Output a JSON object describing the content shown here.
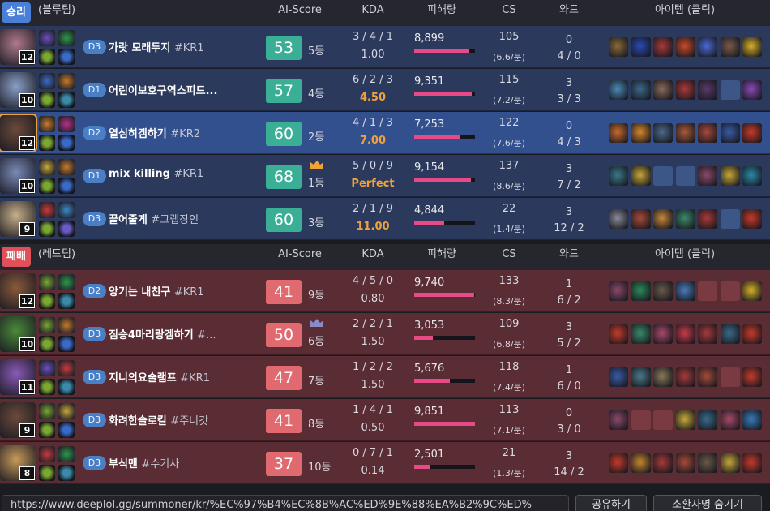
{
  "columns": {
    "ai_score": "AI-Score",
    "kda": "KDA",
    "damage": "피해량",
    "cs": "CS",
    "ward": "와드",
    "items": "아이템 (클릭)"
  },
  "teams": [
    {
      "result": "승리",
      "team": "(블루팀)",
      "result_color": "#4a7fd8",
      "kind": "win",
      "players": [
        {
          "level": "12",
          "tier": "D3",
          "name": "가랏 모래두지",
          "tag": "#KR1",
          "score": "53",
          "rank": "5등",
          "kda": "3 / 4 / 1",
          "ratio": "1.00",
          "ratio_hi": false,
          "damage": "8,899",
          "damage_pct": 0.9,
          "cs": "105",
          "cs_min": "(6.6/분)",
          "ward1": "0",
          "ward2": "4 / 0",
          "crown": null,
          "me": false,
          "champ_color": "#b07a8c",
          "spells": [
            "#6b4ec2",
            "#2c9a4a",
            "#7aa830",
            "#3a6ac8"
          ],
          "items": [
            "#8a6a3a",
            "#2a4ab8",
            "#a83a3a",
            "#c84a2a",
            "#4a6ad8",
            "#7a5a4a",
            "#d8b02a"
          ]
        },
        {
          "level": "10",
          "tier": "D1",
          "name": "어린이보호구역스피드...",
          "tag": "",
          "score": "57",
          "rank": "4등",
          "kda": "6 / 2 / 3",
          "ratio": "4.50",
          "ratio_hi": true,
          "damage": "9,351",
          "damage_pct": 0.95,
          "cs": "115",
          "cs_min": "(7.2/분)",
          "ward1": "3",
          "ward2": "3 / 3",
          "crown": null,
          "me": false,
          "champ_color": "#8aa0c8",
          "spells": [
            "#3a6ac8",
            "#c87a2a",
            "#7aa830",
            "#3a8aa8"
          ],
          "items": [
            "#4a8ab8",
            "#3a6a8a",
            "#8a6a5a",
            "#a83a3a",
            "#5a3a6a",
            "",
            "#8a4ab8"
          ]
        },
        {
          "level": "12",
          "tier": "D2",
          "name": "열심히겜하기",
          "tag": "#KR2",
          "score": "60",
          "rank": "2등",
          "kda": "4 / 1 / 3",
          "ratio": "7.00",
          "ratio_hi": true,
          "damage": "7,253",
          "damage_pct": 0.74,
          "cs": "122",
          "cs_min": "(7.6/분)",
          "ward1": "0",
          "ward2": "4 / 3",
          "crown": null,
          "me": true,
          "champ_color": "#6a4a3a",
          "spells": [
            "#c87a2a",
            "#b8308a",
            "#7aa830",
            "#3a6ac8"
          ],
          "items": [
            "#c86a2a",
            "#d8882a",
            "#4a6a8a",
            "#a85a3a",
            "#a84a3a",
            "#3a5aa8",
            "#c83a2a"
          ]
        },
        {
          "level": "10",
          "tier": "D1",
          "name": "mix killing",
          "tag": "#KR1",
          "score": "68",
          "rank": "1등",
          "kda": "5 / 0 / 9",
          "ratio": "Perfect",
          "ratio_hi": true,
          "damage": "9,154",
          "damage_pct": 0.93,
          "cs": "137",
          "cs_min": "(8.6/분)",
          "ward1": "3",
          "ward2": "7 / 2",
          "crown": "#f0a23a",
          "me": false,
          "champ_color": "#7a8ab8",
          "spells": [
            "#c8a83a",
            "#c87a2a",
            "#7aa830",
            "#3a6ac8"
          ],
          "items": [
            "#3a7a8a",
            "#c8a83a",
            "",
            "",
            "#8a4a6a",
            "#c8a83a",
            "#2a8aa8"
          ]
        },
        {
          "level": "9",
          "tier": "D3",
          "name": "끝어줄게",
          "tag": "#그랩장인",
          "score": "60",
          "rank": "3등",
          "kda": "2 / 1 / 9",
          "ratio": "11.00",
          "ratio_hi": true,
          "damage": "4,844",
          "damage_pct": 0.49,
          "cs": "22",
          "cs_min": "(1.4/분)",
          "ward1": "3",
          "ward2": "12 / 2",
          "crown": null,
          "me": false,
          "champ_color": "#c8b08a",
          "spells": [
            "#c83a3a",
            "#3a8ac8",
            "#7aa830",
            "#6a5ac8"
          ],
          "items": [
            "#8a8a9a",
            "#a84a3a",
            "#c8883a",
            "#3a8a6a",
            "#a83a3a",
            "",
            "#c83a2a"
          ]
        }
      ]
    },
    {
      "result": "패배",
      "team": "(레드팀)",
      "result_color": "#e0505a",
      "kind": "lose",
      "players": [
        {
          "level": "12",
          "tier": "D2",
          "name": "앙기는 내친구",
          "tag": "#KR1",
          "score": "41",
          "rank": "9등",
          "kda": "4 / 5 / 0",
          "ratio": "0.80",
          "ratio_hi": false,
          "damage": "9,740",
          "damage_pct": 0.99,
          "cs": "133",
          "cs_min": "(8.3/분)",
          "ward1": "1",
          "ward2": "6 / 2",
          "crown": null,
          "me": false,
          "champ_color": "#8a5a3a",
          "spells": [
            "#7aa830",
            "#2c9a4a",
            "#7aa830",
            "#3a8aa8"
          ],
          "items": [
            "#8a4a6a",
            "#2a8a5a",
            "#6a5a4a",
            "#4a7ab8",
            "",
            "",
            "#d8b02a"
          ]
        },
        {
          "level": "10",
          "tier": "D3",
          "name": "짐승4마리랑겜하기",
          "tag": "#...",
          "score": "50",
          "rank": "6등",
          "kda": "2 / 2 / 1",
          "ratio": "1.50",
          "ratio_hi": false,
          "damage": "3,053",
          "damage_pct": 0.31,
          "cs": "109",
          "cs_min": "(6.8/분)",
          "ward1": "3",
          "ward2": "5 / 2",
          "crown": "#8a8ac8",
          "me": false,
          "champ_color": "#4a8a3a",
          "spells": [
            "#7aa830",
            "#c87a2a",
            "#7aa830",
            "#3a6ac8"
          ],
          "items": [
            "#c83a2a",
            "#3a8a6a",
            "#a84a6a",
            "#c83a4a",
            "#a83a3a",
            "#3a6a8a",
            "#c83a2a"
          ]
        },
        {
          "level": "11",
          "tier": "D3",
          "name": "지니의요술램프",
          "tag": "#KR1",
          "score": "47",
          "rank": "7등",
          "kda": "1 / 2 / 2",
          "ratio": "1.50",
          "ratio_hi": false,
          "damage": "5,676",
          "damage_pct": 0.58,
          "cs": "118",
          "cs_min": "(7.4/분)",
          "ward1": "1",
          "ward2": "6 / 0",
          "crown": null,
          "me": false,
          "champ_color": "#8a5ab8",
          "spells": [
            "#6b4ec2",
            "#c83a3a",
            "#7aa830",
            "#3a8aa8"
          ],
          "items": [
            "#3a5aa8",
            "#4a7a8a",
            "#8a7a5a",
            "#a83a3a",
            "#a84a3a",
            "",
            "#c83a2a"
          ]
        },
        {
          "level": "9",
          "tier": "D3",
          "name": "화려한솔로킬",
          "tag": "#주니갓",
          "score": "41",
          "rank": "8등",
          "kda": "1 / 4 / 1",
          "ratio": "0.50",
          "ratio_hi": false,
          "damage": "9,851",
          "damage_pct": 1.0,
          "cs": "113",
          "cs_min": "(7.1/분)",
          "ward1": "0",
          "ward2": "3 / 0",
          "crown": null,
          "me": false,
          "champ_color": "#6a4a3a",
          "spells": [
            "#7aa830",
            "#c8a83a",
            "#7aa830",
            "#3a6ac8"
          ],
          "items": [
            "#8a4a6a",
            "",
            "",
            "#c8a83a",
            "#3a6a8a",
            "#a84a6a",
            "#3a7ab8"
          ]
        },
        {
          "level": "8",
          "tier": "D3",
          "name": "부식맨",
          "tag": "#수기사",
          "score": "37",
          "rank": "10등",
          "kda": "0 / 7 / 1",
          "ratio": "0.14",
          "ratio_hi": false,
          "damage": "2,501",
          "damage_pct": 0.25,
          "cs": "21",
          "cs_min": "(1.3/분)",
          "ward1": "3",
          "ward2": "14 / 2",
          "crown": null,
          "me": false,
          "champ_color": "#c89a5a",
          "spells": [
            "#c83a3a",
            "#2c9a4a",
            "#7aa830",
            "#3a8aa8"
          ],
          "items": [
            "#c83a2a",
            "#c8882a",
            "#a83a3a",
            "#a84a3a",
            "#6a5a4a",
            "#c8a83a",
            "#c83a2a"
          ]
        }
      ]
    }
  ],
  "bottom": {
    "url": "https://www.deeplol.gg/summoner/kr/%EC%97%B4%EC%8B%AC%ED%9E%88%EA%B2%9C%ED%",
    "share": "공유하기",
    "hide": "소환사명 숨기기"
  }
}
